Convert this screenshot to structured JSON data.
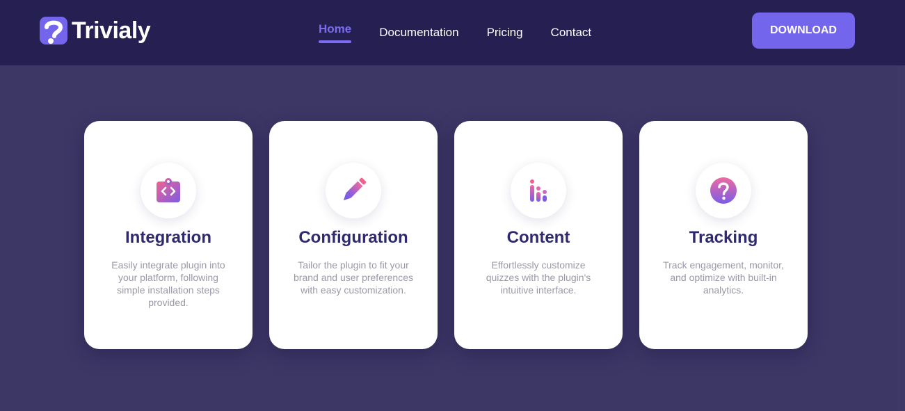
{
  "brand": {
    "name": "Trivialy",
    "logo_icon": "question-mark-logo-icon"
  },
  "nav": {
    "items": [
      {
        "label": "Home",
        "active": true
      },
      {
        "label": "Documentation",
        "active": false
      },
      {
        "label": "Pricing",
        "active": false
      },
      {
        "label": "Contact",
        "active": false
      }
    ],
    "download_label": "DOWNLOAD"
  },
  "colors": {
    "nav_background": "#261f52",
    "page_background": "#3d3766",
    "accent": "#7366ec",
    "title_text": "#2f2a6e",
    "icon_gradient_start": "#f06292",
    "icon_gradient_end": "#7b5ce6"
  },
  "features": [
    {
      "title": "Integration",
      "description": "Easily integrate plugin into your platform, following simple installation steps provided.",
      "icon": "code-clipboard-icon"
    },
    {
      "title": "Configuration",
      "description": "Tailor the plugin to fit your brand and user preferences with easy customization.",
      "icon": "pencil-icon"
    },
    {
      "title": "Content",
      "description": "Effortlessly customize quizzes with the plugin's intuitive interface.",
      "icon": "bar-chart-icon"
    },
    {
      "title": "Tracking",
      "description": "Track engagement, monitor, and optimize with built-in analytics.",
      "icon": "question-circle-icon"
    }
  ]
}
